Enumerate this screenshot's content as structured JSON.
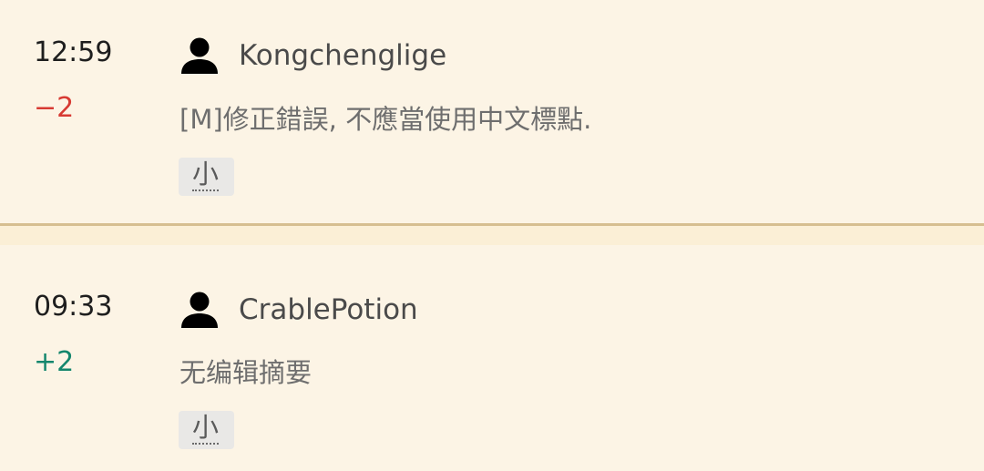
{
  "entries": [
    {
      "time": "12:59",
      "size_change": "−2",
      "size_change_color": "#d73a33",
      "user": "Kongchenglige",
      "user_icon": "user-icon",
      "summary": "[M]修正錯誤, 不應當使用中文標點.",
      "minor_label": "小"
    },
    {
      "time": "09:33",
      "size_change": "+2",
      "size_change_color": "#14866d",
      "user": "CrablePotion",
      "user_icon": "user-icon",
      "summary": "无编辑摘要",
      "minor_label": "小"
    }
  ],
  "colors": {
    "background": "#fcf4e5",
    "divider": "#d6be90",
    "negative": "#d73a33",
    "positive": "#14866d"
  }
}
